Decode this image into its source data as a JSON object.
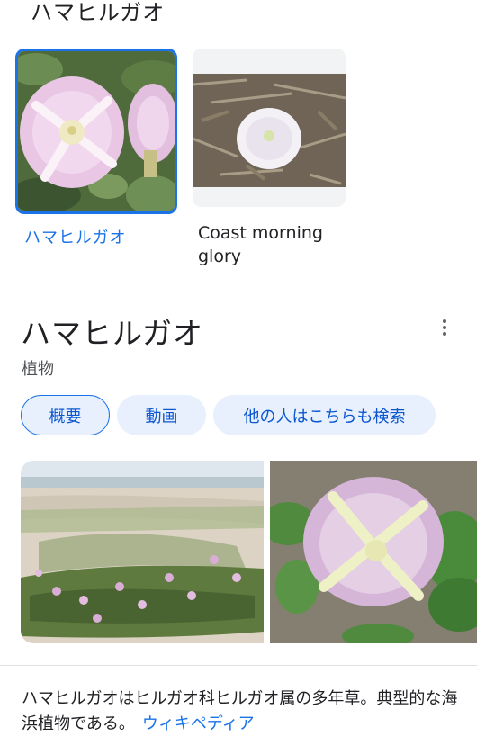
{
  "header": {
    "partial_title": "ハマヒルガオ"
  },
  "image_cards": [
    {
      "label": "ハマヒルガオ",
      "selected": true
    },
    {
      "label": "Coast morning glory",
      "selected": false
    }
  ],
  "knowledge_panel": {
    "title": "ハマヒルガオ",
    "subtitle": "植物",
    "more_icon": "more-vert-icon",
    "chips": [
      {
        "label": "概要",
        "active": true
      },
      {
        "label": "動画",
        "active": false
      },
      {
        "label": "他の人はこちらも検索",
        "active": false
      }
    ],
    "description": "ハマヒルガオはヒルガオ科ヒルガオ属の多年草。典型的な海浜植物である。",
    "source_link": "ウィキペディア"
  },
  "colors": {
    "accent": "#1a73e8",
    "chip_bg": "#e8f0fe",
    "text": "#202124",
    "secondary_text": "#4d5156"
  }
}
